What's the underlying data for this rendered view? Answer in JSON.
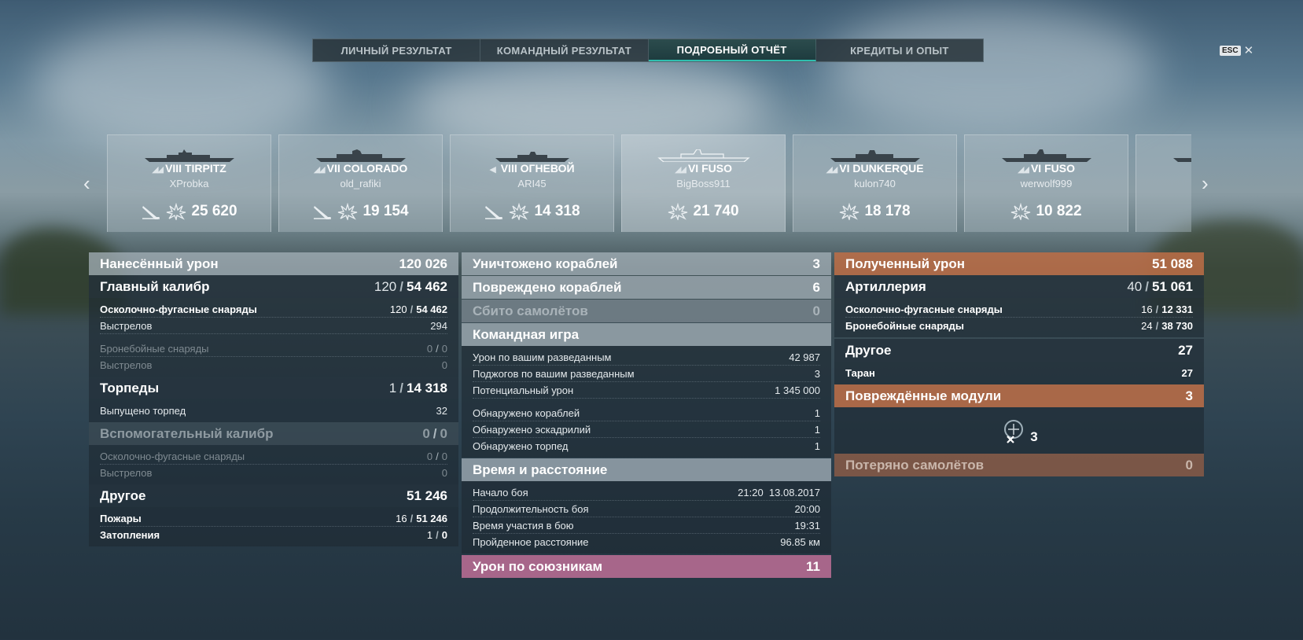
{
  "tabs": [
    {
      "label": "ЛИЧНЫЙ РЕЗУЛЬТАТ"
    },
    {
      "label": "КОМАНДНЫЙ РЕЗУЛЬТАТ"
    },
    {
      "label": "ПОДРОБНЫЙ ОТЧЁТ"
    },
    {
      "label": "КРЕДИТЫ И ОПЫТ"
    }
  ],
  "esc": {
    "key": "ESC",
    "close": "✕"
  },
  "ships": [
    {
      "tier": "VIII",
      "name": "TIRPITZ",
      "player": "XProbka",
      "damage": "25 620"
    },
    {
      "tier": "VII",
      "name": "COLORADO",
      "player": "old_rafiki",
      "damage": "19 154"
    },
    {
      "tier": "VIII",
      "name": "ОГНЕВОЙ",
      "player": "ARI45",
      "damage": "14 318"
    },
    {
      "tier": "VI",
      "name": "FUSO",
      "player": "BigBoss911",
      "damage": "21 740"
    },
    {
      "tier": "VI",
      "name": "DUNKERQUE",
      "player": "kulon740",
      "damage": "18 178"
    },
    {
      "tier": "VI",
      "name": "FUSO",
      "player": "werwolf999",
      "damage": "10 822"
    }
  ],
  "dealt": {
    "title": "Нанесённый урон",
    "total": "120 026",
    "main": {
      "title": "Главный калибр",
      "hits": "120",
      "dmg": "54 462",
      "he_label": "Осколочно-фугасные снаряды",
      "he_hits": "120",
      "he_dmg": "54 462",
      "shots_label": "Выстрелов",
      "shots": "294",
      "ap_label": "Бронебойные снаряды",
      "ap_hits": "0",
      "ap_dmg": "0",
      "ap_shots_label": "Выстрелов",
      "ap_shots": "0"
    },
    "torp": {
      "title": "Торпеды",
      "hits": "1",
      "dmg": "14 318",
      "launched_label": "Выпущено торпед",
      "launched": "32"
    },
    "sec": {
      "title": "Вспомогательный калибр",
      "hits": "0",
      "dmg": "0",
      "he_label": "Осколочно-фугасные снаряды",
      "he_hits": "0",
      "he_dmg": "0",
      "shots_label": "Выстрелов",
      "shots": "0"
    },
    "other": {
      "title": "Другое",
      "dmg": "51 246",
      "fire_label": "Пожары",
      "fire_hits": "16",
      "fire_dmg": "51 246",
      "flood_label": "Затопления",
      "flood_hits": "1",
      "flood_dmg": "0"
    }
  },
  "mid": {
    "destroyed_label": "Уничтожено кораблей",
    "destroyed": "3",
    "damaged_label": "Повреждено кораблей",
    "damaged": "6",
    "planes_label": "Сбито самолётов",
    "planes": "0",
    "team": {
      "title": "Командная игра",
      "rows": [
        {
          "label": "Урон по вашим разведанным",
          "value": "42 987"
        },
        {
          "label": "Поджогов по вашим разведанным",
          "value": "3"
        },
        {
          "label": "Потенциальный урон",
          "value": "1 345 000"
        }
      ],
      "rows2": [
        {
          "label": "Обнаружено кораблей",
          "value": "1"
        },
        {
          "label": "Обнаружено эскадрилий",
          "value": "1"
        },
        {
          "label": "Обнаружено торпед",
          "value": "1"
        }
      ]
    },
    "time": {
      "title": "Время и расстояние",
      "rows": [
        {
          "label": "Начало боя",
          "value": "21:20  13.08.2017"
        },
        {
          "label": "Продолжительность боя",
          "value": "20:00"
        },
        {
          "label": "Время участия в бою",
          "value": "19:31"
        },
        {
          "label": "Пройденное расстояние",
          "value": "96.85 км"
        }
      ]
    },
    "ally_label": "Урон по союзникам",
    "ally": "11"
  },
  "received": {
    "title": "Полученный урон",
    "total": "51 088",
    "art": {
      "title": "Артиллерия",
      "hits": "40",
      "dmg": "51 061",
      "he_label": "Осколочно-фугасные снаряды",
      "he_hits": "16",
      "he_dmg": "12 331",
      "ap_label": "Бронебойные снаряды",
      "ap_hits": "24",
      "ap_dmg": "38 730"
    },
    "other": {
      "title": "Другое",
      "dmg": "27",
      "ram_label": "Таран",
      "ram": "27"
    },
    "modules": {
      "title": "Повреждённые модули",
      "count": "3",
      "icon_count": "3"
    },
    "planes_lost_label": "Потеряно самолётов",
    "planes_lost": "0"
  }
}
